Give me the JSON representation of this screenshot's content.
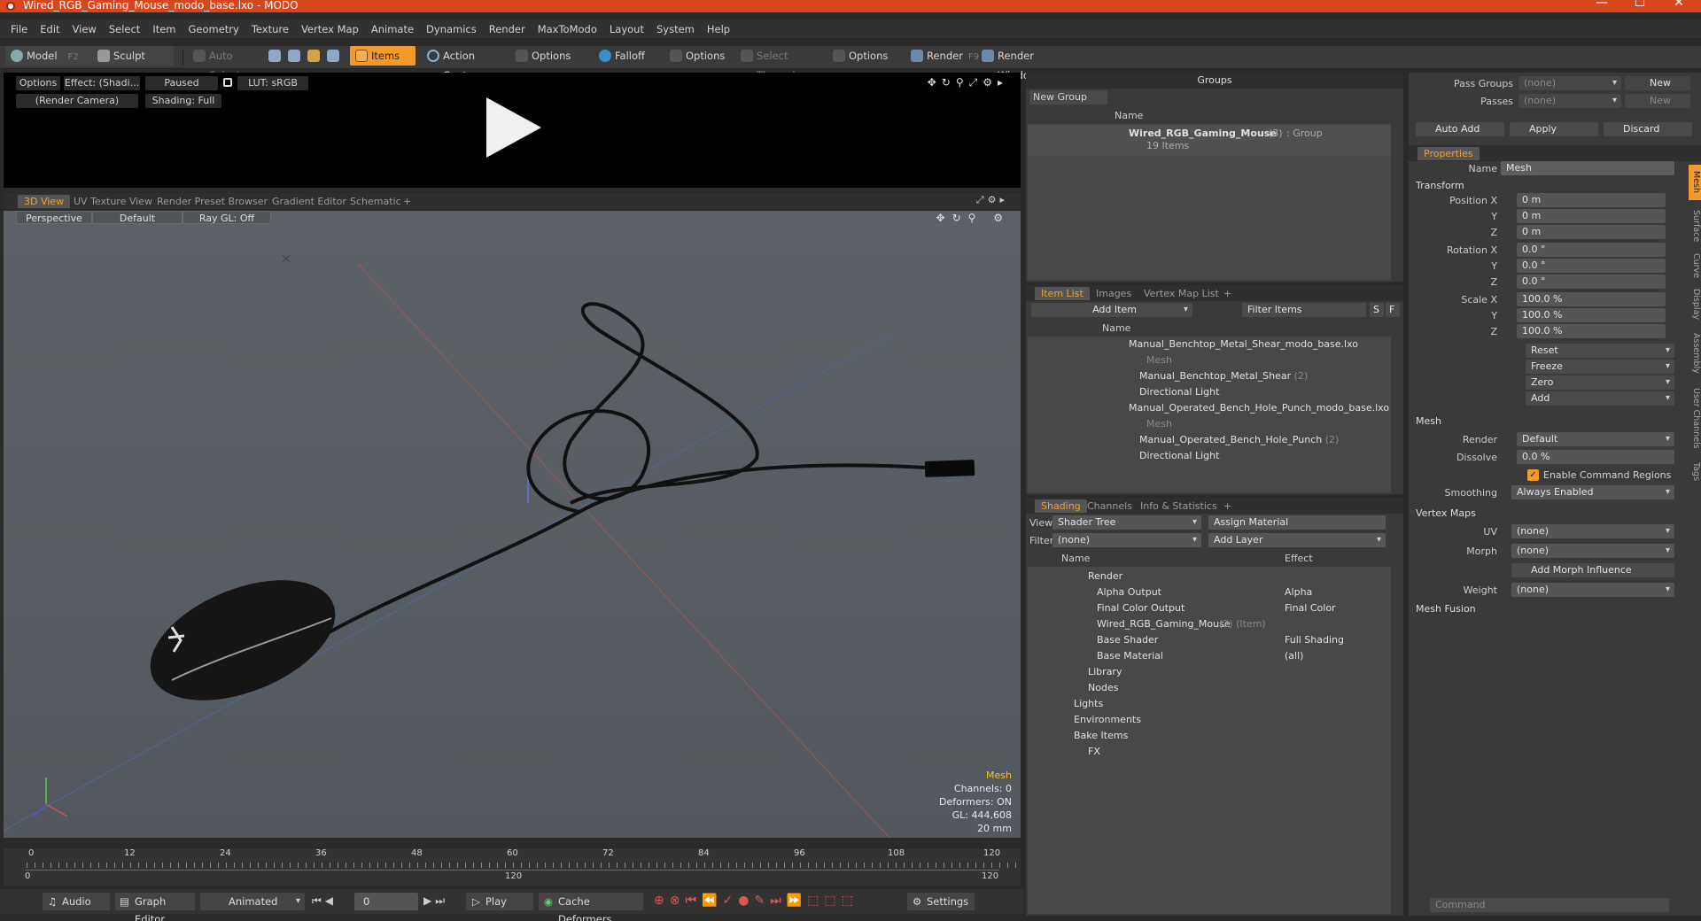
{
  "window": {
    "title": "Wired_RGB_Gaming_Mouse_modo_base.lxo - MODO",
    "minimize": "—",
    "maximize": "☐",
    "close": "✕"
  },
  "menu": [
    "File",
    "Edit",
    "View",
    "Select",
    "Item",
    "Geometry",
    "Texture",
    "Vertex Map",
    "Animate",
    "Dynamics",
    "Render",
    "MaxToModo",
    "Layout",
    "System",
    "Help"
  ],
  "toolbar": {
    "model": "Model",
    "model_key": "F2",
    "sculpt": "Sculpt",
    "auto_select": "Auto Select",
    "items": "Items",
    "action_center": "Action Center",
    "options1": "Options",
    "falloff": "Falloff",
    "options2": "Options",
    "select_through": "Select Through",
    "options3": "Options",
    "render": "Render",
    "render_key": "F9",
    "render_window": "Render Window"
  },
  "preview": {
    "options": "Options",
    "effect": "Effect: (Shadi...",
    "paused": "Paused",
    "lut": "LUT: sRGB",
    "camera": "(Render Camera)",
    "shading": "Shading: Full"
  },
  "view_tabs": [
    "3D View",
    "UV Texture View",
    "Render Preset Browser",
    "Gradient Editor",
    "Schematic",
    "+"
  ],
  "viewport": {
    "perspective": "Perspective",
    "default": "Default",
    "raygl": "Ray GL: Off",
    "hud_title": "Mesh",
    "channels": "Channels: 0",
    "deformers": "Deformers: ON",
    "gl": "GL: 444,608",
    "size": "20 mm"
  },
  "timeline": {
    "ticks": [
      "0",
      "12",
      "24",
      "36",
      "48",
      "60",
      "72",
      "84",
      "96",
      "108",
      "120"
    ],
    "lower": [
      "0",
      "120",
      "120"
    ]
  },
  "bottom": {
    "audio": "Audio",
    "graph_editor": "Graph Editor",
    "animated": "Animated",
    "frame": "0",
    "play": "Play",
    "cache": "Cache Deformers",
    "settings": "Settings"
  },
  "groups": {
    "title": "Groups",
    "new_group": "New Group",
    "col_name": "Name",
    "item_name": "Wired_RGB_Gaming_Mouse",
    "item_count": "(3)",
    "item_type": ": Group",
    "item_sub": "19 Items"
  },
  "itemlist": {
    "tabs": [
      "Item List",
      "Images",
      "Vertex Map List",
      "+"
    ],
    "add_item": "Add Item",
    "filter": "Filter Items",
    "s": "S",
    "f": "F",
    "col_name": "Name",
    "rows": [
      {
        "t": "Manual_Benchtop_Metal_Shear_modo_base.lxo",
        "x": ""
      },
      {
        "t": "Mesh",
        "x": ""
      },
      {
        "t": "Manual_Benchtop_Metal_Shear",
        "x": "(2)"
      },
      {
        "t": "Directional Light",
        "x": ""
      },
      {
        "t": "Manual_Operated_Bench_Hole_Punch_modo_base.lxo",
        "x": ""
      },
      {
        "t": "Mesh",
        "x": ""
      },
      {
        "t": "Manual_Operated_Bench_Hole_Punch",
        "x": "(2)"
      },
      {
        "t": "Directional Light",
        "x": ""
      }
    ]
  },
  "shading": {
    "tabs": [
      "Shading",
      "Channels",
      "Info & Statistics",
      "+"
    ],
    "view_label": "View",
    "view_value": "Shader Tree",
    "assign": "Assign Material",
    "filter_label": "Filter",
    "filter_value": "(none)",
    "add_layer": "Add Layer",
    "col_name": "Name",
    "col_effect": "Effect",
    "rows": [
      {
        "t": "Render",
        "e": ""
      },
      {
        "t": "Alpha Output",
        "e": "Alpha"
      },
      {
        "t": "Final Color Output",
        "e": "Final Color"
      },
      {
        "t": "Wired_RGB_Gaming_Mouse",
        "x": "(2) (Item)",
        "e": ""
      },
      {
        "t": "Base Shader",
        "e": "Full Shading"
      },
      {
        "t": "Base Material",
        "e": "(all)"
      },
      {
        "t": "Library",
        "e": ""
      },
      {
        "t": "Nodes",
        "e": ""
      },
      {
        "t": "Lights",
        "e": ""
      },
      {
        "t": "Environments",
        "e": ""
      },
      {
        "t": "Bake Items",
        "e": ""
      },
      {
        "t": "FX",
        "e": ""
      }
    ]
  },
  "props": {
    "pass_groups": "Pass Groups",
    "passes": "Passes",
    "none": "(none)",
    "new": "New",
    "auto_add": "Auto Add",
    "apply": "Apply",
    "discard": "Discard",
    "tab": "Properties",
    "name_label": "Name",
    "name_value": "Mesh",
    "transform": "Transform",
    "position_x": "Position X",
    "y": "Y",
    "z": "Z",
    "pos": [
      "0 m",
      "0 m",
      "0 m"
    ],
    "rotation_x": "Rotation X",
    "rot": [
      "0.0 °",
      "0.0 °",
      "0.0 °"
    ],
    "scale_x": "Scale X",
    "scale": [
      "100.0 %",
      "100.0 %",
      "100.0 %"
    ],
    "reset": "Reset",
    "freeze": "Freeze",
    "zero": "Zero",
    "add": "Add",
    "mesh": "Mesh",
    "render_label": "Render",
    "render_value": "Default",
    "dissolve_label": "Dissolve",
    "dissolve_value": "0.0 %",
    "enable_cmd": "Enable Command Regions",
    "smoothing_label": "Smoothing",
    "smoothing_value": "Always Enabled",
    "vertex_maps": "Vertex Maps",
    "uv_label": "UV",
    "uv_value": "(none)",
    "morph_label": "Morph",
    "morph_value": "(none)",
    "add_morph": "Add Morph Influence",
    "weight_label": "Weight",
    "weight_value": "(none)",
    "mesh_fusion": "Mesh Fusion",
    "side_tabs": [
      "Mesh",
      "Surface",
      "Curve",
      "Display",
      "Assembly",
      "User Channels",
      "Tags"
    ],
    "command": "Command"
  }
}
